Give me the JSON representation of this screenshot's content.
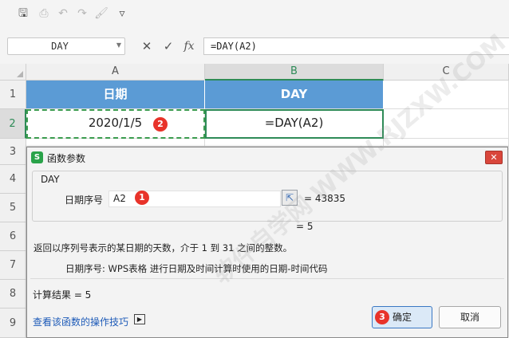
{
  "toolbar": {
    "save": "🖫",
    "preview": "⎙",
    "undo": "↶",
    "redo": "↷",
    "brush": "🖌",
    "more": "▿"
  },
  "formula_bar": {
    "name_box": "DAY",
    "cancel": "✕",
    "confirm": "✓",
    "fx": "fx",
    "formula": "=DAY(A2)"
  },
  "columns": [
    "A",
    "B",
    "C"
  ],
  "rows": [
    "1",
    "2",
    "3",
    "4",
    "5",
    "6",
    "7",
    "8",
    "9"
  ],
  "cells": {
    "a1": "日期",
    "b1": "DAY",
    "a2": "2020/1/5",
    "b2": "=DAY(A2)"
  },
  "badges": {
    "one": "1",
    "two": "2",
    "three": "3"
  },
  "dialog": {
    "title": "函数参数",
    "logo": "S",
    "close": "✕",
    "function_name": "DAY",
    "param_label": "日期序号",
    "param_value": "A2",
    "param_result": "=  43835",
    "function_result": "=  5",
    "description": "返回以序列号表示的某日期的天数，介于 1 到 31 之间的整数。",
    "param_description": "日期序号:   WPS表格 进行日期及时间计算时使用的日期-时间代码",
    "calc_result": "计算结果 =  5",
    "tips_link": "查看该函数的操作技巧",
    "ok": "确定",
    "cancel": "取消"
  },
  "watermark": "软件自学网 WWW.RJZXW.COM",
  "colors": {
    "header_fill": "#5b9bd5",
    "selection": "#2e8b57",
    "badge": "#e8332a",
    "link": "#1e5bb8"
  }
}
